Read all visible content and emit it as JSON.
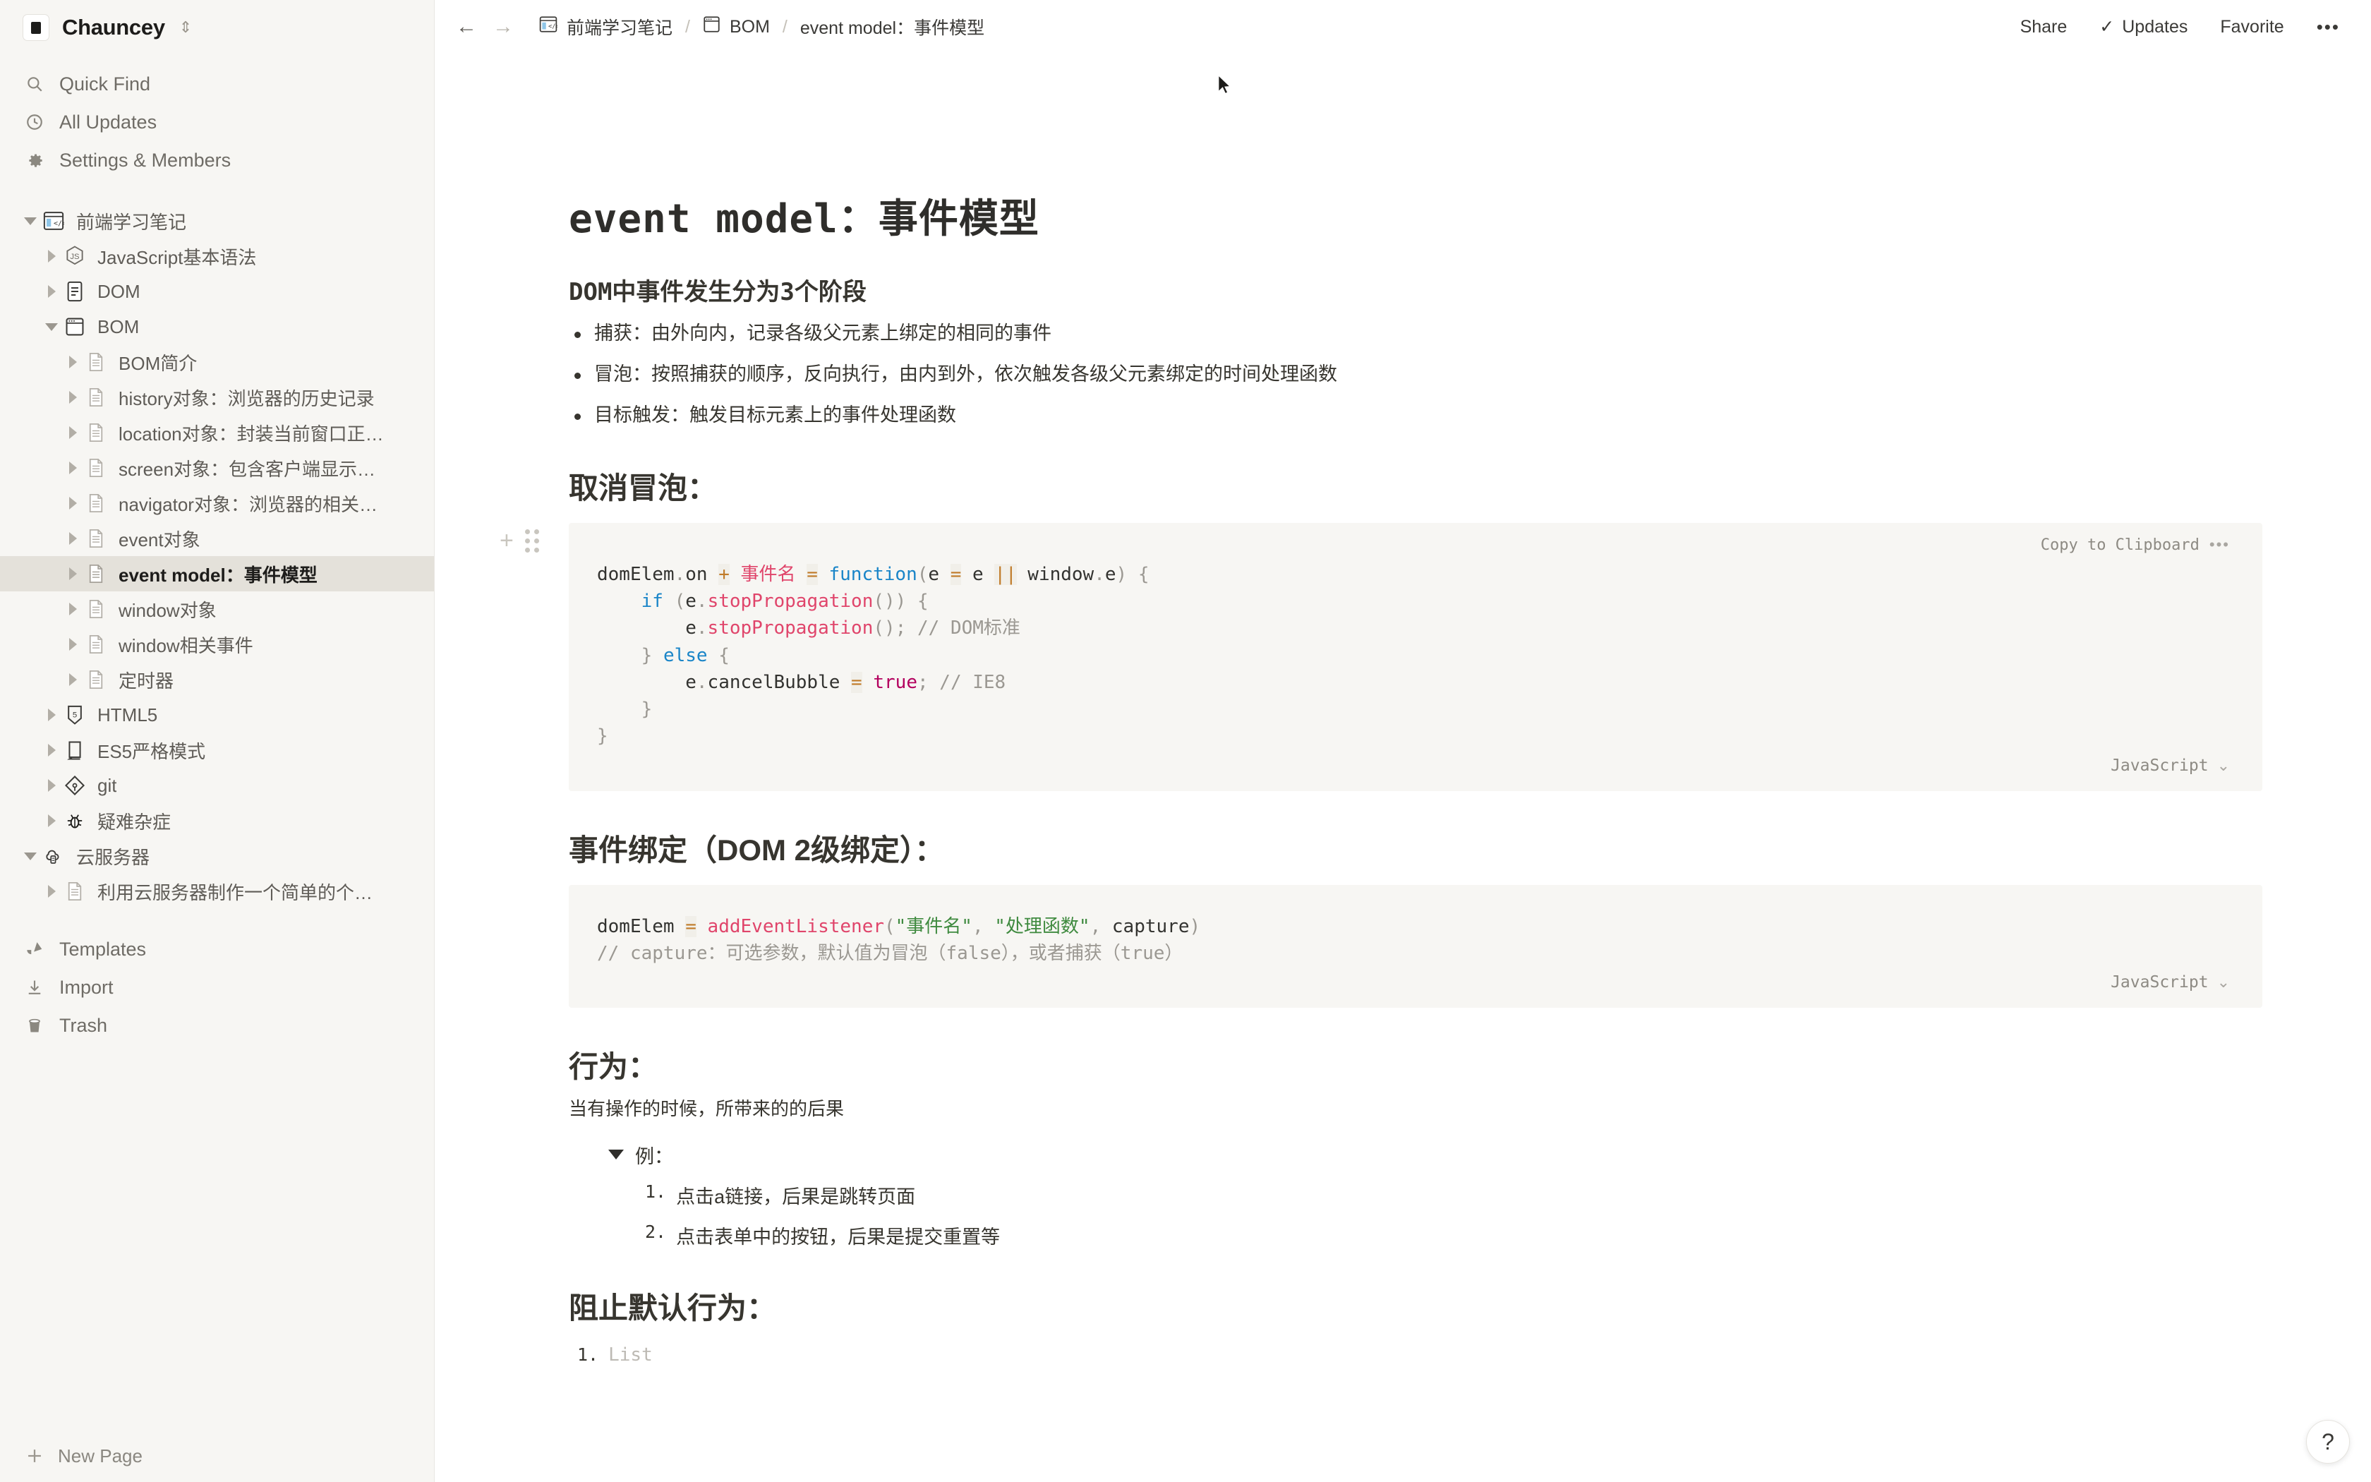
{
  "sidebar": {
    "workspace_name": "Chauncey",
    "nav": [
      {
        "label": "Quick Find",
        "icon": "search-icon"
      },
      {
        "label": "All Updates",
        "icon": "clock-icon"
      },
      {
        "label": "Settings & Members",
        "icon": "gear-icon"
      }
    ],
    "tree": [
      {
        "label": "前端学习笔记",
        "depth": 0,
        "twisty": "down",
        "icon": "browser-code-icon",
        "selected": false
      },
      {
        "label": "JavaScript基本语法",
        "depth": 1,
        "twisty": "right",
        "icon": "js-icon",
        "selected": false
      },
      {
        "label": "DOM",
        "depth": 1,
        "twisty": "right",
        "icon": "doc-icon",
        "selected": false
      },
      {
        "label": "BOM",
        "depth": 1,
        "twisty": "down",
        "icon": "window-icon",
        "selected": false
      },
      {
        "label": "BOM简介",
        "depth": 2,
        "twisty": "right",
        "icon": "page-icon",
        "selected": false
      },
      {
        "label": "history对象：浏览器的历史记录",
        "depth": 2,
        "twisty": "right",
        "icon": "page-icon",
        "selected": false
      },
      {
        "label": "location对象：封装当前窗口正…",
        "depth": 2,
        "twisty": "right",
        "icon": "page-icon",
        "selected": false
      },
      {
        "label": "screen对象：包含客户端显示…",
        "depth": 2,
        "twisty": "right",
        "icon": "page-icon",
        "selected": false
      },
      {
        "label": "navigator对象：浏览器的相关…",
        "depth": 2,
        "twisty": "right",
        "icon": "page-icon",
        "selected": false
      },
      {
        "label": "event对象",
        "depth": 2,
        "twisty": "right",
        "icon": "page-icon",
        "selected": false
      },
      {
        "label": "event model：事件模型",
        "depth": 2,
        "twisty": "right",
        "icon": "page-icon",
        "selected": true
      },
      {
        "label": "window对象",
        "depth": 2,
        "twisty": "right",
        "icon": "page-icon",
        "selected": false
      },
      {
        "label": "window相关事件",
        "depth": 2,
        "twisty": "right",
        "icon": "page-icon",
        "selected": false
      },
      {
        "label": "定时器",
        "depth": 2,
        "twisty": "right",
        "icon": "page-icon",
        "selected": false
      },
      {
        "label": "HTML5",
        "depth": 1,
        "twisty": "right",
        "icon": "html5-icon",
        "selected": false
      },
      {
        "label": "ES5严格模式",
        "depth": 1,
        "twisty": "right",
        "icon": "es5-icon",
        "selected": false
      },
      {
        "label": "git",
        "depth": 1,
        "twisty": "right",
        "icon": "git-icon",
        "selected": false
      },
      {
        "label": "疑难杂症",
        "depth": 1,
        "twisty": "right",
        "icon": "bug-icon",
        "selected": false
      },
      {
        "label": "云服务器",
        "depth": 0,
        "twisty": "down",
        "icon": "cloud-server-icon",
        "selected": false
      },
      {
        "label": "利用云服务器制作一个简单的个…",
        "depth": 1,
        "twisty": "right",
        "icon": "page-icon",
        "selected": false
      }
    ],
    "bottom": [
      {
        "label": "Templates",
        "icon": "templates-icon"
      },
      {
        "label": "Import",
        "icon": "import-icon"
      },
      {
        "label": "Trash",
        "icon": "trash-icon"
      }
    ],
    "new_page_label": "New Page"
  },
  "topbar": {
    "back_arrow": "←",
    "forward_arrow": "→",
    "breadcrumbs": [
      {
        "label": "前端学习笔记",
        "icon": "browser-code-icon"
      },
      {
        "label": "BOM",
        "icon": "window-icon"
      },
      {
        "label": "event model：事件模型",
        "icon": ""
      }
    ],
    "separator": "/",
    "share_label": "Share",
    "updates_label": "Updates",
    "updates_check": "✓",
    "favorite_label": "Favorite",
    "more_label": "•••"
  },
  "doc": {
    "title": "event model：事件模型",
    "section1_heading": "DOM中事件发生分为3个阶段",
    "bullets": [
      "捕获：由外向内，记录各级父元素上绑定的相同的事件",
      "冒泡：按照捕获的顺序，反向执行，由内到外，依次触发各级父元素绑定的时间处理函数",
      "目标触发：触发目标元素上的事件处理函数"
    ],
    "section2_heading": "取消冒泡：",
    "code1": {
      "copy_label": "Copy to Clipboard",
      "more_dots": "•••",
      "language": "JavaScript",
      "chevron": "⌄",
      "lines": [
        [
          {
            "t": "domElem",
            "c": "plain"
          },
          {
            "t": ".",
            "c": "punc"
          },
          {
            "t": "on ",
            "c": "plain"
          },
          {
            "t": "+",
            "c": "op"
          },
          {
            "t": " ",
            "c": "plain"
          },
          {
            "t": "事件名",
            "c": "pink"
          },
          {
            "t": " ",
            "c": "plain"
          },
          {
            "t": "=",
            "c": "op"
          },
          {
            "t": " ",
            "c": "plain"
          },
          {
            "t": "function",
            "c": "kw"
          },
          {
            "t": "(",
            "c": "punc"
          },
          {
            "t": "e ",
            "c": "plain"
          },
          {
            "t": "=",
            "c": "op"
          },
          {
            "t": " e ",
            "c": "plain"
          },
          {
            "t": "||",
            "c": "op"
          },
          {
            "t": " window",
            "c": "plain"
          },
          {
            "t": ".",
            "c": "punc"
          },
          {
            "t": "e",
            "c": "plain"
          },
          {
            "t": ") {",
            "c": "punc"
          }
        ],
        [
          {
            "t": "    ",
            "c": "plain"
          },
          {
            "t": "if",
            "c": "kw"
          },
          {
            "t": " (",
            "c": "punc"
          },
          {
            "t": "e",
            "c": "plain"
          },
          {
            "t": ".",
            "c": "punc"
          },
          {
            "t": "stopPropagation",
            "c": "fn"
          },
          {
            "t": "()) {",
            "c": "punc"
          }
        ],
        [
          {
            "t": "        ",
            "c": "plain"
          },
          {
            "t": "e",
            "c": "plain"
          },
          {
            "t": ".",
            "c": "punc"
          },
          {
            "t": "stopPropagation",
            "c": "fn"
          },
          {
            "t": "()",
            "c": "punc"
          },
          {
            "t": ";",
            "c": "punc"
          },
          {
            "t": " // DOM标准",
            "c": "cmt"
          }
        ],
        [
          {
            "t": "    ",
            "c": "plain"
          },
          {
            "t": "}",
            "c": "punc"
          },
          {
            "t": " ",
            "c": "plain"
          },
          {
            "t": "else",
            "c": "kw"
          },
          {
            "t": " {",
            "c": "punc"
          }
        ],
        [
          {
            "t": "        ",
            "c": "plain"
          },
          {
            "t": "e",
            "c": "plain"
          },
          {
            "t": ".",
            "c": "punc"
          },
          {
            "t": "cancelBubble ",
            "c": "plain"
          },
          {
            "t": "=",
            "c": "op"
          },
          {
            "t": " ",
            "c": "plain"
          },
          {
            "t": "true",
            "c": "val"
          },
          {
            "t": ";",
            "c": "punc"
          },
          {
            "t": " // IE8",
            "c": "cmt"
          }
        ],
        [
          {
            "t": "    ",
            "c": "plain"
          },
          {
            "t": "}",
            "c": "punc"
          }
        ],
        [
          {
            "t": "}",
            "c": "punc"
          }
        ]
      ]
    },
    "section3_heading": "事件绑定（DOM 2级绑定）：",
    "code2": {
      "language": "JavaScript",
      "chevron": "⌄",
      "lines": [
        [
          {
            "t": "domElem ",
            "c": "plain"
          },
          {
            "t": "=",
            "c": "op"
          },
          {
            "t": " ",
            "c": "plain"
          },
          {
            "t": "addEventListener",
            "c": "fn"
          },
          {
            "t": "(",
            "c": "punc"
          },
          {
            "t": "\"事件名\"",
            "c": "str"
          },
          {
            "t": ", ",
            "c": "punc"
          },
          {
            "t": "\"处理函数\"",
            "c": "str"
          },
          {
            "t": ", ",
            "c": "punc"
          },
          {
            "t": "capture",
            "c": "plain"
          },
          {
            "t": ")",
            "c": "punc"
          }
        ],
        [
          {
            "t": "// capture：可选参数，默认值为冒泡（false），或者捕获（true）",
            "c": "cmt"
          }
        ]
      ]
    },
    "section4_heading": "行为：",
    "section4_para": "当有操作的时候，所带来的的后果",
    "toggle_label": "例：",
    "toggle_items": [
      {
        "n": "1.",
        "text": "点击a链接，后果是跳转页面"
      },
      {
        "n": "2.",
        "text": "点击表单中的按钮，后果是提交重置等"
      }
    ],
    "section5_heading": "阻止默认行为：",
    "list_item_number": "1.",
    "list_placeholder": "List"
  },
  "help_button_label": "?"
}
